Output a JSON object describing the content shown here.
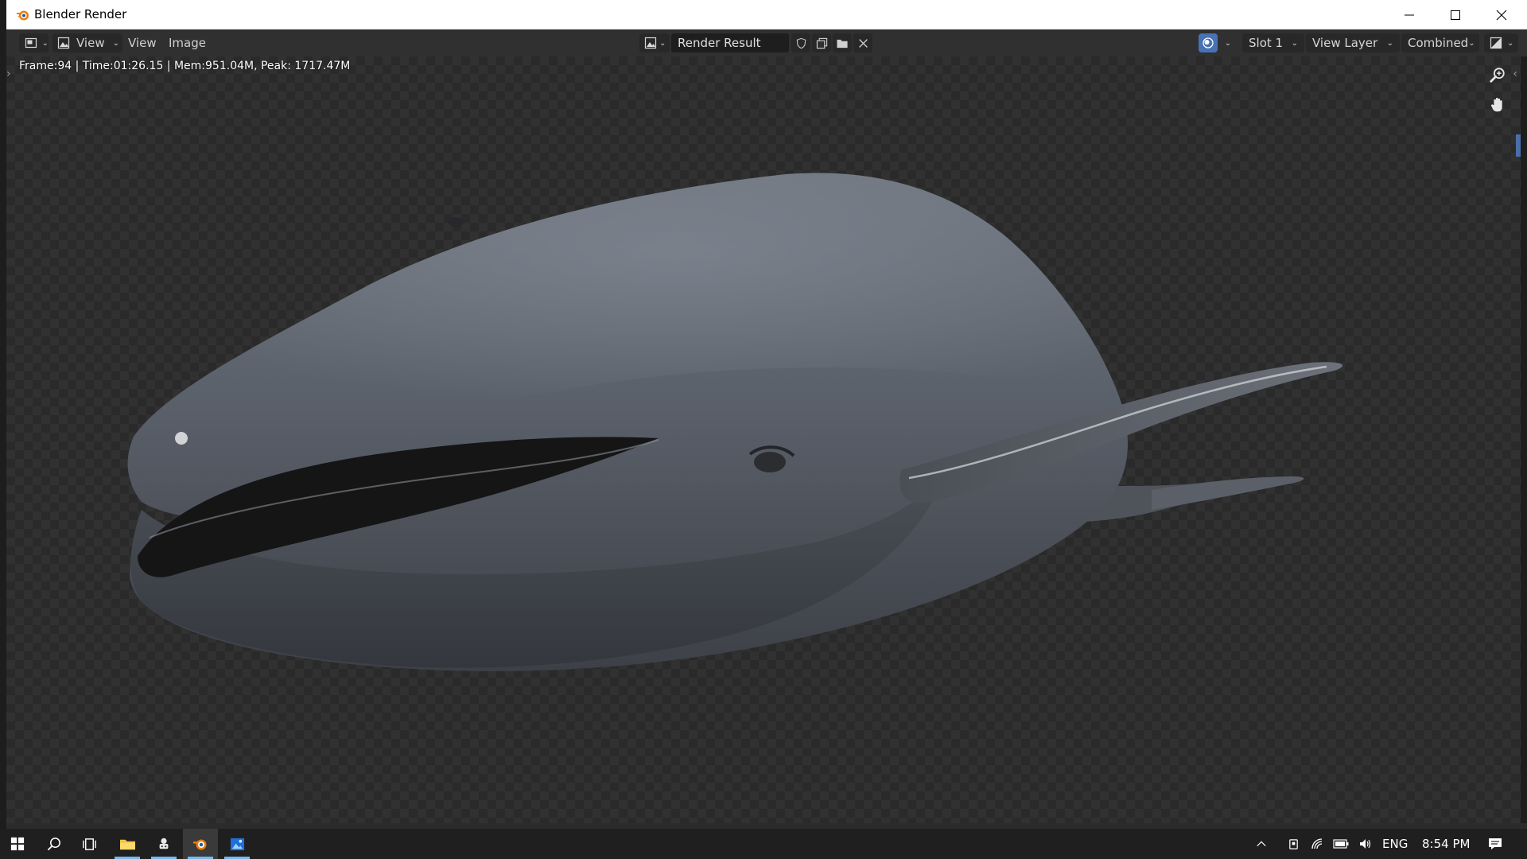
{
  "window": {
    "title": "Blender Render",
    "controls": [
      "minimize-icon",
      "maximize-icon",
      "close-icon"
    ]
  },
  "header": {
    "editor_type_icon": "image-editor-icon",
    "view_mode_label": "View",
    "menus": [
      "View",
      "Image"
    ],
    "image_browse_icon": "image-browse-icon",
    "image_name": "Render Result",
    "image_actions": [
      "fake-user-icon",
      "new-image-icon",
      "open-folder-icon",
      "unlink-icon"
    ],
    "pass_toggle_icon": "render-layer-icon",
    "slot": "Slot 1",
    "view_layer": "View Layer",
    "render_pass": "Combined",
    "display_channels_icon": "display-channels-icon"
  },
  "canvas": {
    "stats": "Frame:94 | Time:01:26.15 | Mem:951.04M, Peak: 1717.47M",
    "tools": [
      "zoom-icon",
      "pan-hand-icon"
    ],
    "subject": "whale render"
  },
  "taskbar": {
    "items": [
      "windows-start-icon",
      "search-icon",
      "task-view-icon",
      "file-explorer-icon",
      "app-icon",
      "blender-icon",
      "photos-icon"
    ],
    "tray_icons": [
      "chevron-up-icon",
      "device-icon",
      "wifi-icon",
      "battery-icon",
      "volume-icon"
    ],
    "language": "ENG",
    "time": "8:54 PM",
    "notification_icon": "action-center-icon"
  },
  "colors": {
    "accent": "#76b9ed",
    "blender_orange": "#e87d0d",
    "header_bg": "#303030",
    "canvas_dark": "#2a2a2a",
    "canvas_light": "#313131"
  }
}
